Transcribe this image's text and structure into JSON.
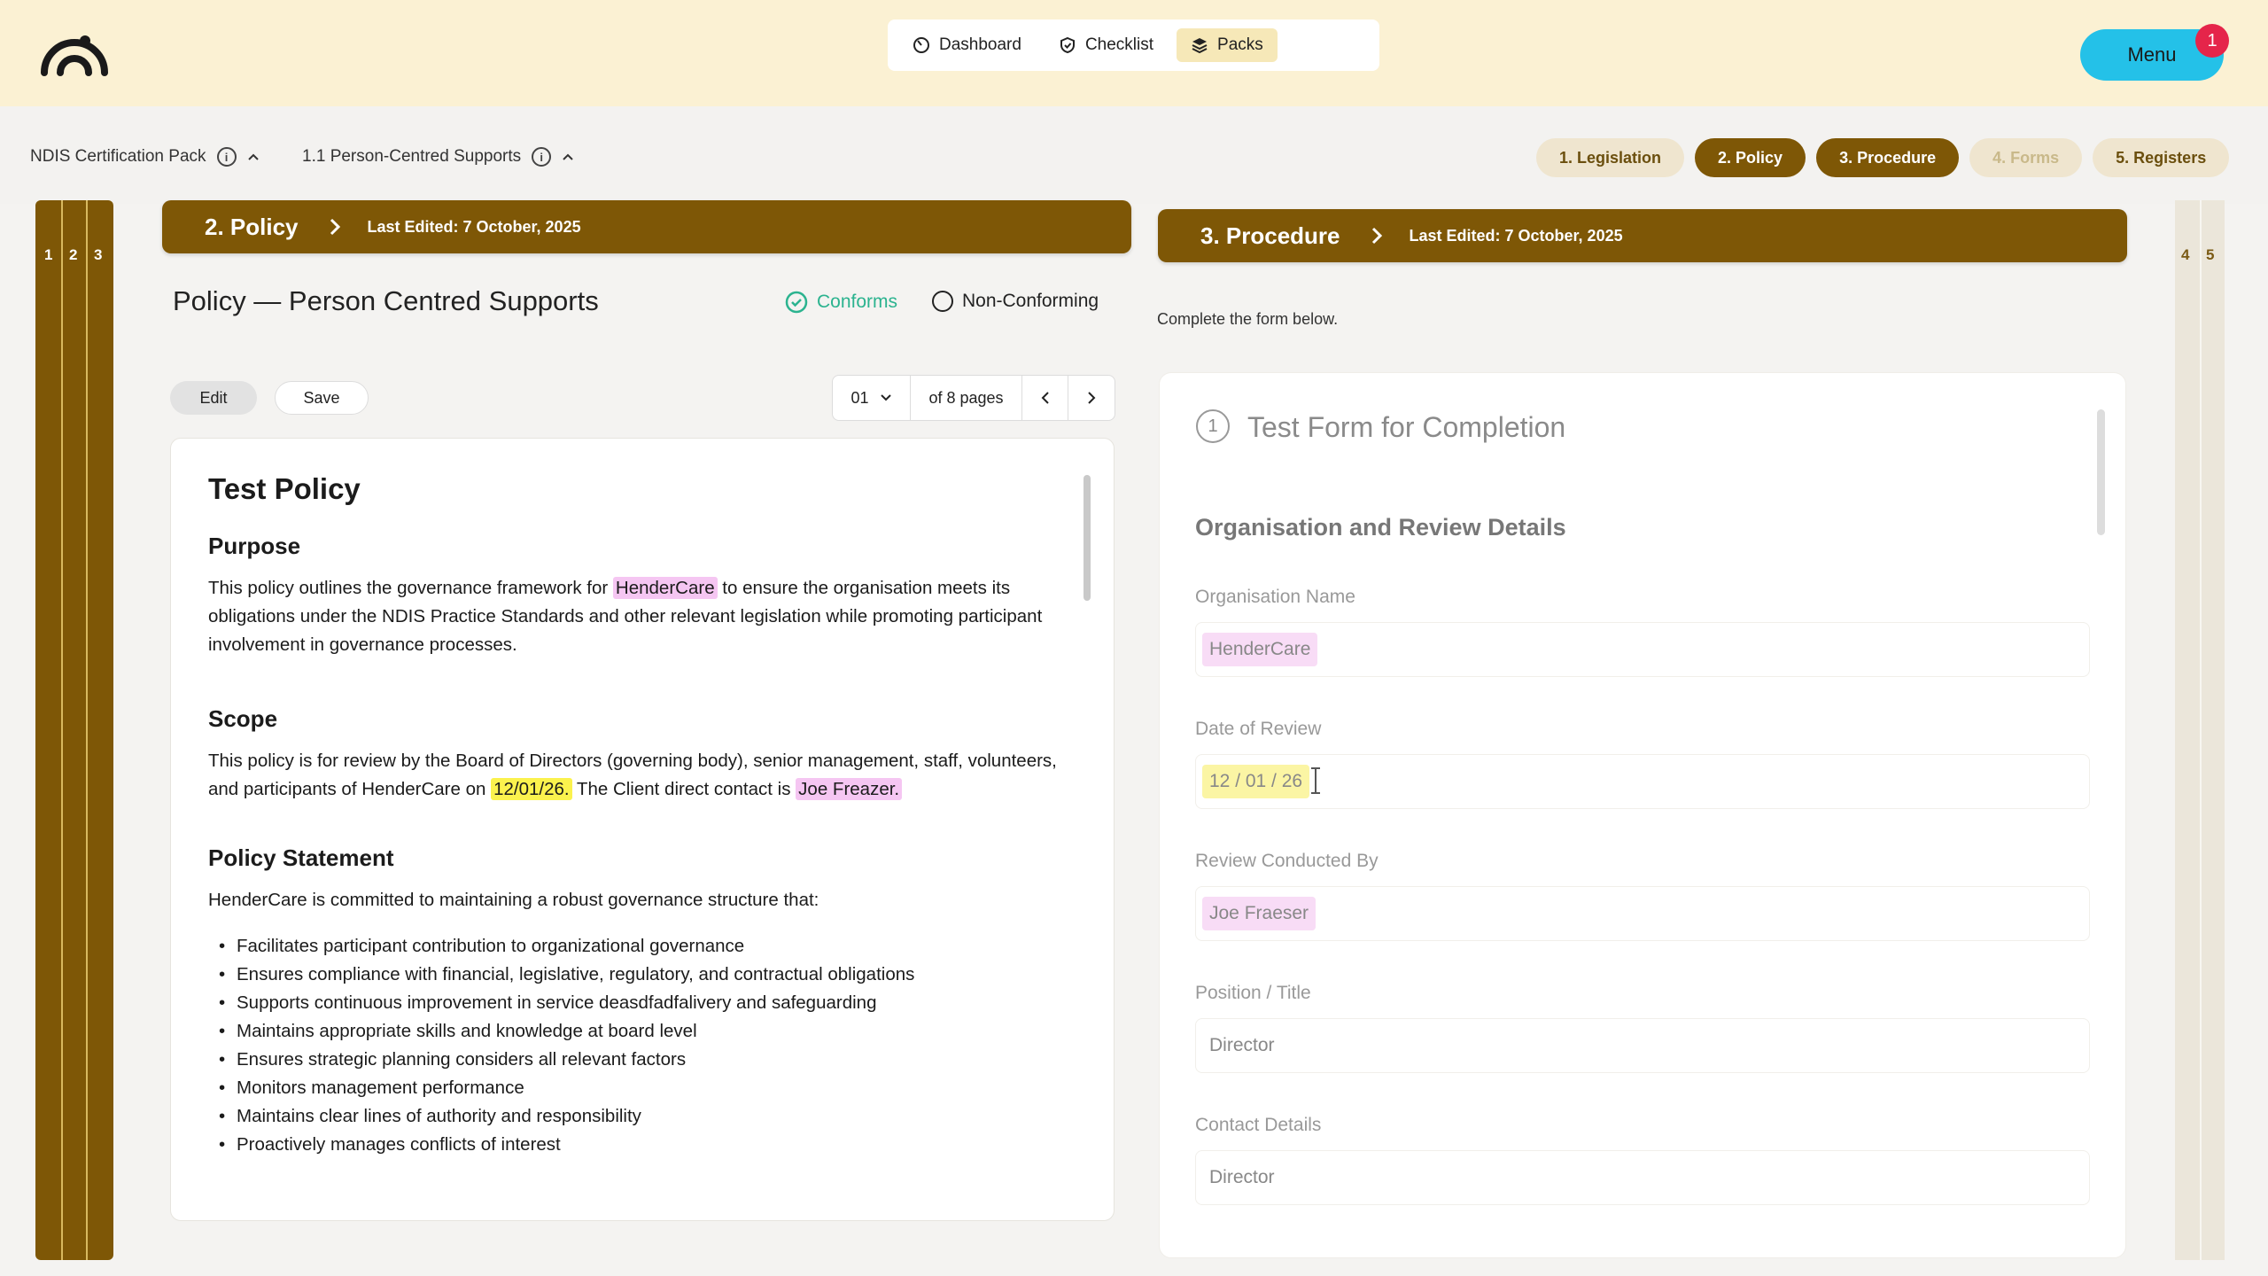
{
  "topnav": {
    "items": [
      {
        "label": "Dashboard",
        "icon": "dashboard-icon"
      },
      {
        "label": "Checklist",
        "icon": "shield-check-icon"
      },
      {
        "label": "Packs",
        "icon": "layers-icon"
      }
    ],
    "menu_label": "Menu",
    "menu_badge": "1"
  },
  "breadcrumb": {
    "pack": "NDIS Certification Pack",
    "section": "1.1  Person-Centred Supports"
  },
  "steps": [
    {
      "label": "1. Legislation",
      "state": "normal"
    },
    {
      "label": "2. Policy",
      "state": "active"
    },
    {
      "label": "3. Procedure",
      "state": "active"
    },
    {
      "label": "4. Forms",
      "state": "disabled"
    },
    {
      "label": "5. Registers",
      "state": "normal"
    }
  ],
  "rails": {
    "left": [
      "1",
      "2",
      "3"
    ],
    "right": [
      "4",
      "5"
    ]
  },
  "policy_panel": {
    "title": "2. Policy",
    "last_edited": "Last Edited: 7 October, 2025",
    "doc_name": "Policy — Person Centred Supports",
    "conforms_label": "Conforms",
    "nonconforming_label": "Non-Conforming",
    "edit_label": "Edit",
    "save_label": "Save",
    "page_select": "01",
    "page_total": "of 8 pages"
  },
  "document": {
    "heading": "Test Policy",
    "purpose_heading": "Purpose",
    "purpose_1": "This policy outlines the governance framework for",
    "purpose_org": "HenderCare",
    "purpose_2": "to ensure the organisation meets its obligations under the NDIS Practice Standards and other relevant legislation while promoting participant involvement in governance processes.",
    "scope_heading": "Scope",
    "scope_1": "This policy is for review by the Board of Directors (governing body), senior management, staff, volunteers, and participants of HenderCare on",
    "scope_date": "12/01/26.",
    "scope_2": "The Client direct contact is",
    "scope_contact": "Joe Freazer.",
    "statement_heading": "Policy Statement",
    "statement_intro": "HenderCare is committed to maintaining a robust governance structure that:",
    "bullets": [
      "Facilitates participant contribution to organizational governance",
      "Ensures compliance with financial, legislative, regulatory, and contractual obligations",
      "Supports continuous improvement in service deasdfadfalivery and safeguarding",
      "Maintains appropriate skills and knowledge at board level",
      "Ensures strategic planning considers all relevant factors",
      "Monitors management performance",
      "Maintains clear lines of authority and responsibility",
      "Proactively manages conflicts of interest"
    ]
  },
  "procedure_panel": {
    "title": "3. Procedure",
    "last_edited": "Last Edited: 7 October, 2025",
    "subtitle": "Complete the form below.",
    "form_number": "1",
    "form_title": "Test Form for Completion",
    "section_title": "Organisation and Review Details",
    "fields": [
      {
        "label": "Organisation Name",
        "value": "HenderCare",
        "highlight": "pink"
      },
      {
        "label": "Date of Review",
        "value": "12 / 01 / 26",
        "highlight": "yellow"
      },
      {
        "label": "Review Conducted By",
        "value": "Joe Fraeser",
        "highlight": "pink"
      },
      {
        "label": "Position / Title",
        "value": "Director",
        "highlight": "none"
      },
      {
        "label": "Contact Details",
        "value": "Director",
        "highlight": "none"
      }
    ]
  },
  "colors": {
    "brand_brown": "#7e5706",
    "topbar_bg": "#fbf1d3",
    "menu_cyan": "#24c1e8",
    "badge_red": "#e5254a",
    "conform_green": "#2bb38f",
    "highlight_pink": "#f5c6f2",
    "highlight_yellow": "#fbf24d"
  }
}
